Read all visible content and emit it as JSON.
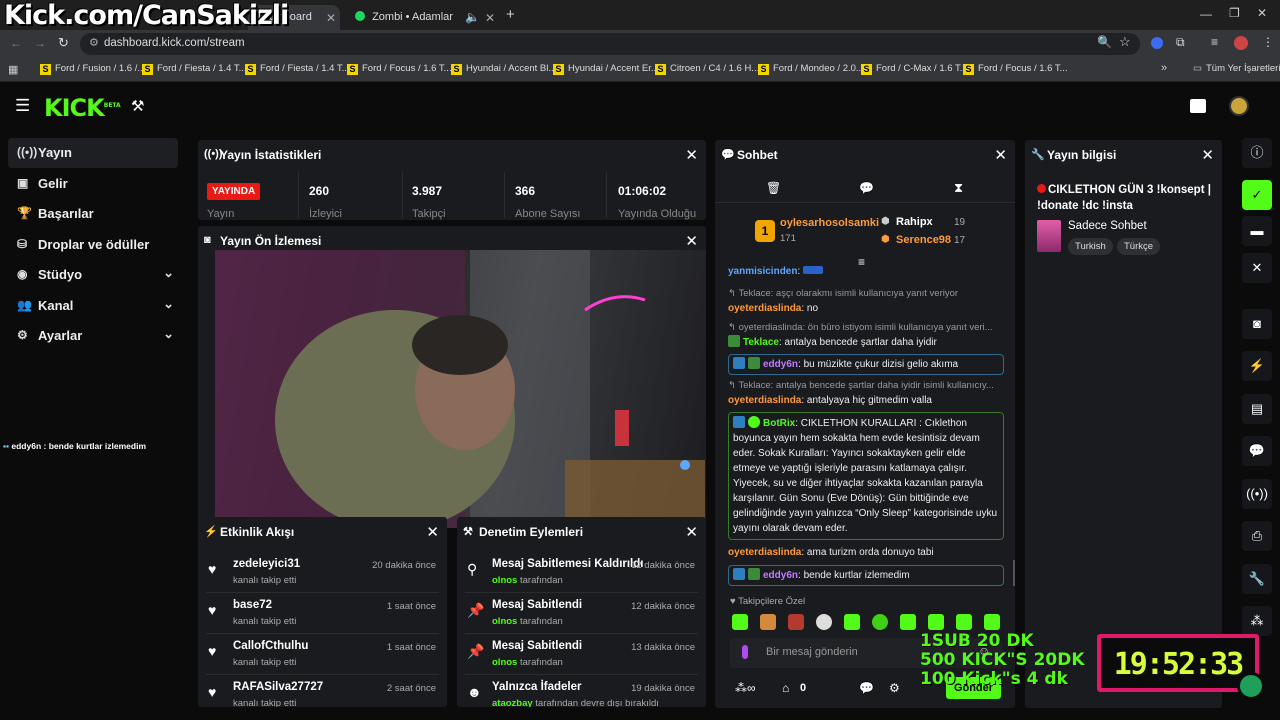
{
  "browser": {
    "tabs": [
      {
        "label": "Dashboard"
      },
      {
        "label": "Zombi • Adamlar"
      }
    ],
    "url": "dashboard.kick.com/stream",
    "bookmarks": [
      "Ford / Fusion / 1.6 /...",
      "Ford / Fiesta / 1.4 T...",
      "Ford / Fiesta / 1.4 T...",
      "Ford / Focus / 1.6 T...",
      "Hyundai / Accent Bl...",
      "Hyundai / Accent Er...",
      "Citroen / C4 / 1.6 H...",
      "Ford / Mondeo / 2.0...",
      "Ford / C-Max / 1.6 T...",
      "Ford / Focus / 1.6 T..."
    ],
    "all_bookmarks": "Tüm Yer İşaretleri"
  },
  "overlay": {
    "channel": "Kick.com/CanSakizli",
    "donation_lines": [
      "1SUB 20 DK",
      "500 KICK\"S 20DK",
      "100 Kick\"s   4 dk"
    ],
    "clock": "19:52:33",
    "chat_ticker": "eddy6n : bende kurtlar izlemedim"
  },
  "kick": {
    "logo": "KICK",
    "logo_badge": "BETA"
  },
  "sidebar": {
    "items": [
      {
        "label": "Yayın",
        "icon": "broadcast-icon",
        "active": true
      },
      {
        "label": "Gelir",
        "icon": "revenue-icon"
      },
      {
        "label": "Başarılar",
        "icon": "trophy-icon"
      },
      {
        "label": "Droplar ve ödüller",
        "icon": "gift-icon"
      },
      {
        "label": "Stüdyo",
        "icon": "studio-icon"
      },
      {
        "label": "Kanal",
        "icon": "channel-icon"
      },
      {
        "label": "Ayarlar",
        "icon": "gear-icon"
      }
    ]
  },
  "stats": {
    "title": "Yayın İstatistikleri",
    "live_badge": "YAYINDA",
    "live_label": "Yayın",
    "items": [
      {
        "value": "260",
        "label": "İzleyici"
      },
      {
        "value": "3.987",
        "label": "Takipçi"
      },
      {
        "value": "366",
        "label": "Abone Sayısı"
      },
      {
        "value": "01:06:02",
        "label": "Yayında Olduğu"
      }
    ]
  },
  "preview": {
    "title": "Yayın Ön İzlemesi"
  },
  "activity": {
    "title": "Etkinlik Akışı",
    "events": [
      {
        "name": "zedeleyici31",
        "sub": "kanalı takip etti",
        "time": "20 dakika önce"
      },
      {
        "name": "base72",
        "sub": "kanalı takip etti",
        "time": "1 saat önce"
      },
      {
        "name": "CallofCthulhu",
        "sub": "kanalı takip etti",
        "time": "1 saat önce"
      },
      {
        "name": "RAFASilva27727",
        "sub": "kanalı takip etti",
        "time": "2 saat önce"
      }
    ]
  },
  "moderation": {
    "title": "Denetim Eylemleri",
    "actions": [
      {
        "action": "Mesaj Sabitlemesi Kaldırıldı",
        "by": "olnos",
        "suffix": "tarafından",
        "time": "12 dakika önce"
      },
      {
        "action": "Mesaj Sabitlendi",
        "by": "olnos",
        "suffix": "tarafından",
        "time": "12 dakika önce"
      },
      {
        "action": "Mesaj Sabitlendi",
        "by": "olnos",
        "suffix": "tarafından",
        "time": "13 dakika önce"
      },
      {
        "action": "Yalnızca İfadeler",
        "by": "ataozbay",
        "suffix": "tarafından devre dışı bırakıldı",
        "time": "19 dakika önce"
      }
    ]
  },
  "chat": {
    "title": "Sohbet",
    "leaderboard": {
      "first": {
        "name": "oylesarhosolsamki",
        "count": "171",
        "rank": "1"
      },
      "second": {
        "name": "Rahipx",
        "count": "19"
      },
      "third": {
        "name": "Serence98",
        "count": "17"
      }
    },
    "messages": {
      "m0_user": "yanmisicinden",
      "m1_reply": "Teklace: aşçı olarakmı isimli kullanıcıya yanıt veriyor",
      "m1_user": "oyeterdiaslinda",
      "m1_text": "no",
      "m2_reply": "oyeterdiaslinda: ön büro istiyom isimli kullanıcıya yanıt veri...",
      "m2_user": "Teklace",
      "m2_text": "antalya bencede şartlar daha iyidir",
      "m3_user": "eddy6n",
      "m3_text": "bu müzikte çukur dizisi gelio akıma",
      "m4_reply": "Teklace: antalya bencede şartlar daha iyidir isimli kullanıcıy...",
      "m4_user": "oyeterdiaslinda",
      "m4_text": "antalyaya hiç gitmedim valla",
      "m5_user": "BotRix",
      "m5_text": "CIKLETHON KURALLARI : Cıklethon boyunca yayın hem sokakta hem evde kesintisiz devam eder. Sokak Kuralları: Yayıncı sokaktayken gelir elde etmeye ve yaptığı işleriyle parasını katlamaya çalışır. Yiyecek, su ve diğer ihtiyaçlar sokakta kazanılan parayla karşılanır. Gün Sonu (Eve Dönüş): Gün bittiğinde eve gelindiğinde yayın yalnızca “Only Sleep” kategorisinde uyku yayını olarak devam eder.",
      "m6_user": "oyeterdiaslinda",
      "m6_text": "ama turizm orda donuyo tabi",
      "m7_user": "eddy6n",
      "m7_text": "bende kurtlar izlemedim"
    },
    "followers_label": "Takipçilere Özel",
    "input_placeholder": "Bir mesaj gönderin",
    "points": "0",
    "send_label": "Gönder"
  },
  "info": {
    "title": "Yayın bilgisi",
    "stream_title": "CIKLETHON GÜN 3 !konsept | !donate !dc !insta",
    "category": "Sadece Sohbet",
    "tags": [
      "Turkish",
      "Türkçe"
    ]
  },
  "colors": {
    "accent": "#53fc18",
    "live": "#e91916",
    "clock_border": "#e0196a"
  }
}
